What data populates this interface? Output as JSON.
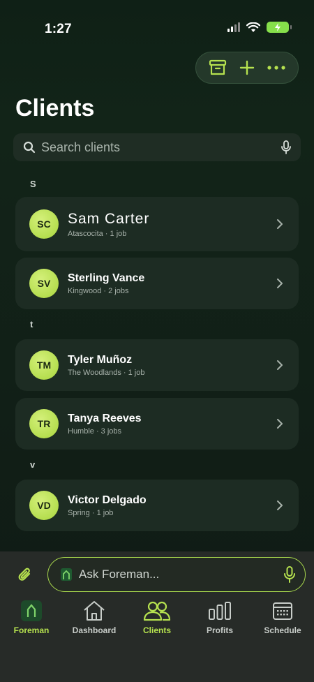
{
  "status": {
    "time": "1:27"
  },
  "page": {
    "title": "Clients"
  },
  "search": {
    "placeholder": "Search clients"
  },
  "sections": [
    {
      "letter": "S",
      "clients": [
        {
          "initials": "SC",
          "name": "Sam Carter",
          "subtitle": "Atascocita · 1 job"
        },
        {
          "initials": "SV",
          "name": "Sterling Vance",
          "subtitle": "Kingwood · 2 jobs"
        }
      ]
    },
    {
      "letter": "t",
      "clients": [
        {
          "initials": "TM",
          "name": "Tyler Muñoz",
          "subtitle": "The Woodlands · 1 job"
        },
        {
          "initials": "TR",
          "name": "Tanya Reeves",
          "subtitle": "Humble · 3 jobs"
        }
      ]
    },
    {
      "letter": "v",
      "clients": [
        {
          "initials": "VD",
          "name": "Victor Delgado",
          "subtitle": "Spring · 1 job"
        }
      ]
    }
  ],
  "ask": {
    "placeholder": "Ask Foreman..."
  },
  "tabs": [
    {
      "label": "Foreman",
      "icon": "foreman-icon"
    },
    {
      "label": "Dashboard",
      "icon": "house-icon"
    },
    {
      "label": "Clients",
      "icon": "people-icon",
      "active": true
    },
    {
      "label": "Profits",
      "icon": "bars-icon"
    },
    {
      "label": "Schedule",
      "icon": "calendar-icon"
    }
  ],
  "colors": {
    "accent": "#b6e24f",
    "card": "#1d2c23",
    "panel": "#272b28"
  }
}
